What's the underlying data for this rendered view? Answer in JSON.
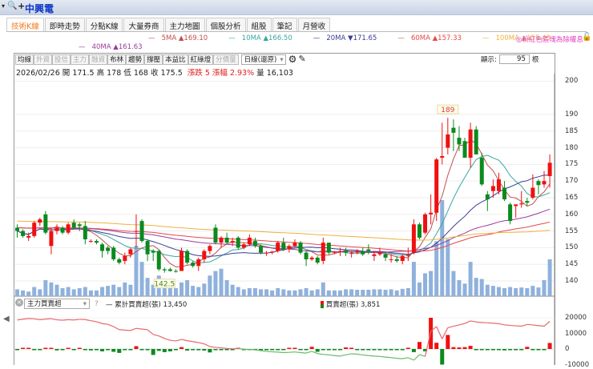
{
  "header": {
    "stock_name": "中興電",
    "caret": "▾",
    "search_icon": "🔍",
    "plus": "+"
  },
  "tabs": [
    "技術K線",
    "即時走勢",
    "分點K線",
    "大量券商",
    "主力地圖",
    "個股分析",
    "組股",
    "筆記",
    "月營收"
  ],
  "ma_legend": [
    {
      "label": "5MA",
      "arrow": "▲",
      "value": "169.10",
      "color": "#c0504d"
    },
    {
      "label": "10MA",
      "arrow": "▲",
      "value": "166.50",
      "color": "#3aa6a0"
    },
    {
      "label": "20MA",
      "arrow": "▼",
      "value": "171.65",
      "color": "#3a3d96"
    },
    {
      "label": "60MA",
      "arrow": "▲",
      "value": "157.33",
      "color": "#e8484a"
    },
    {
      "label": "100MA",
      "arrow": "▲",
      "value": "155.43",
      "color": "#f0b040"
    },
    {
      "label": "40MA",
      "arrow": "▲",
      "value": "161.63",
      "color": "#9b3c9b"
    }
  ],
  "notice": "◎粉紅色區塊為除權息",
  "toolbar": {
    "buttons": [
      {
        "label": "均線",
        "dim": false
      },
      {
        "label": "外資",
        "dim": true
      },
      {
        "label": "投信",
        "dim": true
      },
      {
        "label": "主力",
        "dim": true
      },
      {
        "label": "融資",
        "dim": true
      },
      {
        "label": "布林",
        "dim": false
      },
      {
        "label": "趨勢",
        "dim": false
      },
      {
        "label": "撐壓",
        "dim": false
      },
      {
        "label": "本益比",
        "dim": false
      },
      {
        "label": "紅綠燈",
        "dim": false
      },
      {
        "label": "分價量",
        "dim": true
      }
    ],
    "period": "日線(還原)",
    "display_label": "顯示:",
    "display_count": "95",
    "display_unit": "根"
  },
  "info": {
    "date": "2026/02/26",
    "open_label": "開",
    "open": "171.5",
    "high_label": "高",
    "high": "178",
    "low_label": "低",
    "low": "168",
    "close_label": "收",
    "close": "175.5",
    "change": "漲跌 5",
    "pct": "漲幅 2.93%",
    "vol_label": "量",
    "volume": "16,103"
  },
  "price_axis": {
    "min": 140,
    "max": 200,
    "ticks": [
      "200",
      "190",
      "185",
      "180",
      "175",
      "170",
      "165",
      "160",
      "155",
      "150",
      "145",
      "140"
    ]
  },
  "annotations": {
    "high": "189",
    "low": "142.5"
  },
  "candles": [
    [
      156,
      157,
      153,
      155,
      3000
    ],
    [
      155,
      155.5,
      153,
      153.5,
      2500
    ],
    [
      153,
      154.5,
      152,
      153.5,
      2000
    ],
    [
      153.5,
      158,
      153,
      157.5,
      4000
    ],
    [
      157.5,
      159,
      156.5,
      158.5,
      3000
    ],
    [
      160,
      161,
      154,
      154.5,
      7000
    ],
    [
      150.5,
      156,
      148,
      155,
      6000
    ],
    [
      155,
      157,
      154,
      156,
      5000
    ],
    [
      156,
      156.5,
      154,
      154.5,
      3500
    ],
    [
      154.5,
      157.5,
      154,
      157,
      4000
    ],
    [
      157.5,
      158.5,
      155.5,
      156,
      3000
    ],
    [
      157,
      157.5,
      155,
      156.5,
      3500
    ],
    [
      156.5,
      158,
      151,
      152.5,
      4000
    ],
    [
      152,
      152.5,
      151.5,
      152,
      2500
    ],
    [
      152,
      152.5,
      151,
      151.5,
      2500
    ],
    [
      151,
      151.5,
      147,
      149,
      4000
    ],
    [
      150,
      150.5,
      148,
      149,
      4500
    ],
    [
      150,
      150.5,
      146,
      146.5,
      5000
    ],
    [
      146.5,
      147,
      145,
      145.5,
      4000
    ],
    [
      146,
      148.5,
      145,
      147.5,
      6000
    ],
    [
      148,
      150,
      147,
      149.5,
      5000
    ],
    [
      155,
      160,
      150,
      155,
      22000
    ],
    [
      158,
      158.5,
      151.5,
      152,
      15000
    ],
    [
      152,
      152.5,
      146,
      148,
      8000
    ],
    [
      149,
      149.5,
      146,
      148.5,
      5000
    ],
    [
      149,
      149.5,
      143,
      143.5,
      9000
    ],
    [
      143.5,
      144,
      142.5,
      143.2,
      4000
    ],
    [
      143.5,
      144,
      142.8,
      143,
      4000
    ],
    [
      143,
      143.5,
      142.5,
      142.8,
      3500
    ],
    [
      143,
      150,
      143,
      149,
      6000
    ],
    [
      149,
      149.5,
      145,
      145.5,
      7000
    ],
    [
      145.5,
      146,
      144,
      144.5,
      4500
    ],
    [
      144.5,
      147,
      143,
      146.5,
      4000
    ],
    [
      146.5,
      149.5,
      145.5,
      149,
      5500
    ],
    [
      149,
      151,
      148,
      150.5,
      9000
    ],
    [
      156,
      157,
      151,
      151.5,
      11000
    ],
    [
      151.5,
      153.5,
      150,
      153,
      12000
    ],
    [
      153,
      154.5,
      151,
      151.5,
      7000
    ],
    [
      151.5,
      153,
      150.5,
      152,
      5000
    ],
    [
      153,
      153.5,
      149.5,
      150,
      4000
    ],
    [
      150,
      151.5,
      149.5,
      151,
      3000
    ],
    [
      151,
      154,
      150.5,
      153,
      3500
    ],
    [
      152,
      153,
      150,
      150.5,
      3500
    ],
    [
      150.5,
      151,
      148,
      148.5,
      3000
    ],
    [
      148.5,
      149,
      147.5,
      148.5,
      3000
    ],
    [
      148.5,
      149,
      148,
      148.8,
      2500
    ],
    [
      149,
      152,
      148.5,
      151.5,
      3500
    ],
    [
      151.5,
      153,
      149,
      149.5,
      3000
    ],
    [
      149.5,
      151,
      148.5,
      150.5,
      2500
    ],
    [
      150.5,
      152.5,
      150,
      151.5,
      2500
    ],
    [
      151.5,
      152,
      148,
      148.5,
      3000
    ],
    [
      148.5,
      149,
      144.5,
      146.5,
      3500
    ],
    [
      146.5,
      147.5,
      146,
      147,
      2500
    ],
    [
      147,
      147.5,
      145,
      145.5,
      3000
    ],
    [
      146,
      153,
      145,
      151.5,
      6000
    ],
    [
      151.5,
      151.5,
      148,
      148.5,
      2500
    ],
    [
      148.5,
      149,
      148,
      148.8,
      2500
    ],
    [
      149,
      150,
      147.5,
      149,
      2500
    ],
    [
      149,
      150,
      147.5,
      148.5,
      3000
    ],
    [
      148.5,
      149,
      147,
      148.5,
      3000
    ],
    [
      148.5,
      149.5,
      148,
      149,
      2800
    ],
    [
      149,
      150,
      147.5,
      148,
      2800
    ],
    [
      149.5,
      151,
      148,
      149,
      2800
    ],
    [
      147.5,
      149,
      146,
      148,
      3000
    ],
    [
      148,
      150,
      147.5,
      148.5,
      3000
    ],
    [
      148,
      148.5,
      146,
      147,
      2800
    ],
    [
      146.5,
      148,
      145.5,
      146.5,
      3000
    ],
    [
      146.5,
      147.5,
      145.5,
      146,
      2500
    ],
    [
      146,
      148,
      145,
      147.5,
      3200
    ],
    [
      147.5,
      150,
      146,
      147.8,
      3500
    ],
    [
      148.5,
      158.5,
      148,
      157,
      15000
    ],
    [
      157,
      157.5,
      152.5,
      153,
      6000
    ],
    [
      154.5,
      160.5,
      154,
      160,
      10000
    ],
    [
      160,
      166,
      157,
      160.5,
      11000
    ],
    [
      160.5,
      177,
      158,
      176.5,
      24000
    ],
    [
      177,
      187.5,
      175,
      177.5,
      42000
    ],
    [
      180,
      189,
      178,
      184,
      25000
    ],
    [
      186,
      188.5,
      179,
      184.5,
      11000
    ],
    [
      183,
      186.5,
      179,
      181,
      7000
    ],
    [
      182,
      183,
      177,
      177,
      5500
    ],
    [
      177,
      187.5,
      174,
      185.5,
      15000
    ],
    [
      185.5,
      186.5,
      178,
      178,
      8000
    ],
    [
      177,
      178.5,
      168.5,
      169,
      7500
    ],
    [
      166,
      167,
      161,
      164.5,
      5000
    ],
    [
      167,
      170.5,
      165,
      168.5,
      4500
    ],
    [
      167,
      172.5,
      166,
      170.5,
      4000
    ],
    [
      168,
      170,
      164,
      164.5,
      3500
    ],
    [
      163,
      163.5,
      157,
      158,
      4000
    ],
    [
      162.5,
      163,
      159,
      163,
      3500
    ],
    [
      163,
      167,
      162,
      163.3,
      3800
    ],
    [
      164,
      165,
      162.5,
      163.5,
      3500
    ],
    [
      165,
      172,
      164.5,
      168,
      4500
    ],
    [
      170,
      170.5,
      166,
      168.8,
      3800
    ],
    [
      169,
      173,
      168,
      170,
      7000
    ],
    [
      171.5,
      178,
      168,
      175.5,
      16103
    ]
  ],
  "lower": {
    "indicator": "主力買賣超",
    "help": "?",
    "cum_label": "累計買賣超(張)",
    "cum_value": "13,450",
    "net_label": "買賣超(張)",
    "net_value": "3,851",
    "axis": [
      "20000",
      "10000",
      "0",
      "-10000"
    ],
    "net": [
      -300,
      600,
      500,
      -200,
      -700,
      500,
      300,
      -900,
      -300,
      400,
      -200,
      500,
      -200,
      -900,
      -800,
      -1500,
      -600,
      -1800,
      -2500,
      -300,
      -400,
      1800,
      -600,
      -500,
      -3800,
      -1200,
      -2000,
      -1500,
      -500,
      1200,
      -1000,
      -700,
      -800,
      -1000,
      -2200,
      -600,
      -400,
      -500,
      -300,
      200,
      -500,
      -300,
      -200,
      -600,
      -700,
      -300,
      -200,
      -400,
      200,
      300,
      -500,
      -400,
      1400,
      -1800,
      -700,
      -300,
      -600,
      -400,
      1000,
      800,
      -300,
      -600,
      -500,
      -400,
      -300,
      -500,
      -400,
      -600,
      -300,
      800,
      -2000,
      4500,
      -1500,
      20000,
      4000,
      -10000,
      9000,
      1200,
      1000,
      1200,
      2000,
      -800,
      -400,
      -300,
      -300,
      -400,
      -900,
      -500,
      -300,
      -300,
      1400,
      -400,
      -600,
      -400,
      3851
    ]
  },
  "colors": {
    "up": "#f01010",
    "down": "#0a8a1e",
    "volume": "#8fb1dc",
    "cum_line_up": "#e8676b",
    "cum_line_down": "#66bb66"
  }
}
